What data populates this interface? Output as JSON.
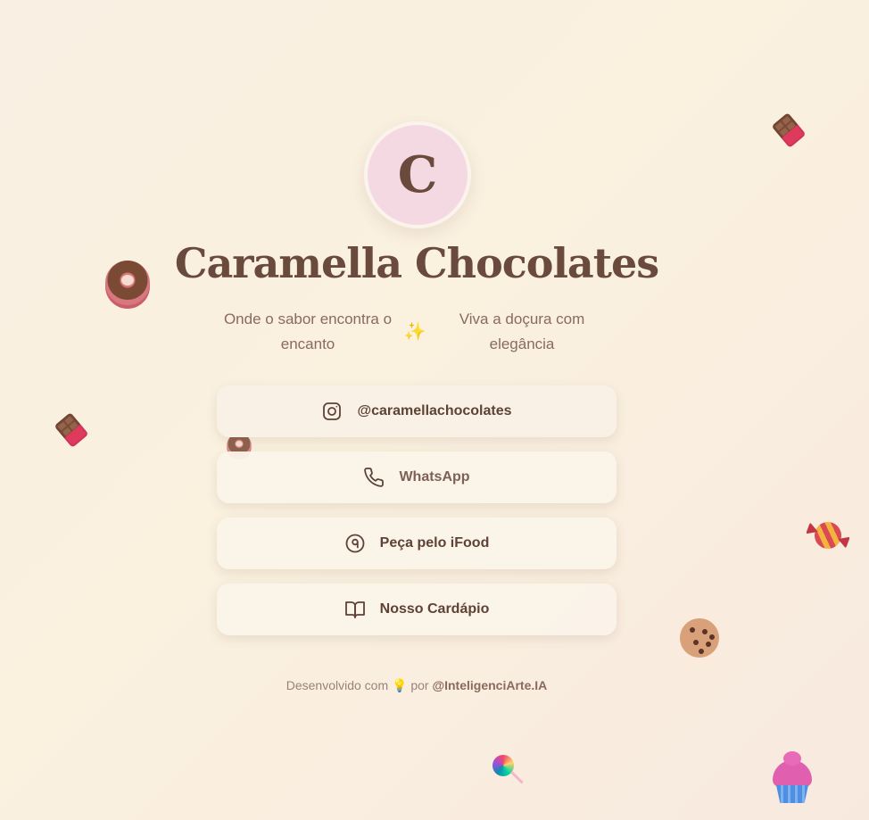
{
  "profile": {
    "avatar_letter": "C",
    "title": "Caramella Chocolates"
  },
  "tagline": {
    "left": "Onde o sabor encontra o encanto",
    "icon": "sparkle-icon",
    "right": "Viva a doçura com elegância"
  },
  "links": [
    {
      "label": "@caramellachocolates",
      "icon": "instagram-icon"
    },
    {
      "label": "WhatsApp",
      "icon": "phone-icon"
    },
    {
      "label": "Peça pelo iFood",
      "icon": "ifood-icon"
    },
    {
      "label": "Nosso Cardápio",
      "icon": "book-icon"
    }
  ],
  "footer": {
    "prefix": "Desenvolvido com",
    "icon": "lightbulb-icon",
    "middle": "por",
    "handle": "@InteligenciArte.IA"
  },
  "colors": {
    "title": "#6b4a3e",
    "avatar_bg": "#f4d9e2",
    "button_bg": "#faf1e6",
    "background_start": "#f9efe2",
    "background_end": "#f8e9df"
  }
}
